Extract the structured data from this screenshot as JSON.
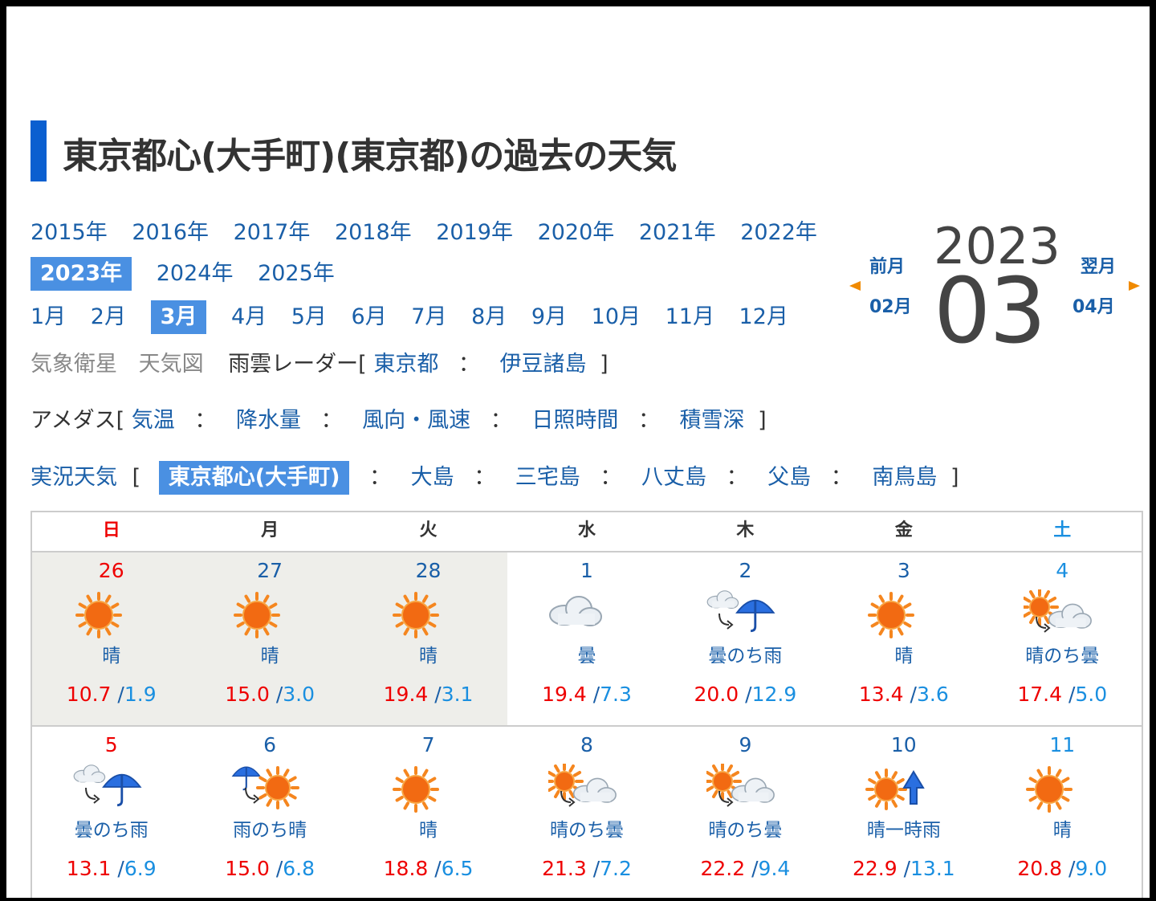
{
  "page_title": "東京都心(大手町)(東京都)の過去の天気",
  "years": [
    "2015年",
    "2016年",
    "2017年",
    "2018年",
    "2019年",
    "2020年",
    "2021年",
    "2022年",
    "2023年",
    "2024年",
    "2025年"
  ],
  "selected_year": "2023年",
  "months": [
    "1月",
    "2月",
    "3月",
    "4月",
    "5月",
    "6月",
    "7月",
    "8月",
    "9月",
    "10月",
    "11月",
    "12月"
  ],
  "selected_month": "3月",
  "links": {
    "satellite": "気象衛星",
    "weather_map": "天気図",
    "radar_label": "雨雲レーダー[",
    "radar_tokyo": "東京都",
    "radar_izu": "伊豆諸島",
    "close_bracket": "]",
    "amedas_label": "アメダス[",
    "amedas_temp": "気温",
    "amedas_rain": "降水量",
    "amedas_wind": "風向・風速",
    "amedas_sun": "日照時間",
    "amedas_snow": "積雪深",
    "actual_label": "実況天気",
    "open_bracket": "[",
    "actual_selected": "東京都心(大手町)",
    "actual_oshima": "大島",
    "actual_miyake": "三宅島",
    "actual_hachijo": "八丈島",
    "actual_chichi": "父島",
    "actual_minami": "南鳥島",
    "sep": "："
  },
  "month_nav": {
    "prev_label": "前月",
    "prev_month": "02月",
    "next_label": "翌月",
    "next_month": "04月",
    "year": "2023",
    "month": "03",
    "arrow_color": "#f08a00"
  },
  "weekdays": [
    "日",
    "月",
    "火",
    "水",
    "木",
    "金",
    "土"
  ],
  "weeks": [
    [
      {
        "day": "26",
        "icon": "sun-icon",
        "desc": "晴",
        "hi": "10.7",
        "lo": "1.9",
        "prev": true
      },
      {
        "day": "27",
        "icon": "sun-icon",
        "desc": "晴",
        "hi": "15.0",
        "lo": "3.0",
        "prev": true
      },
      {
        "day": "28",
        "icon": "sun-icon",
        "desc": "晴",
        "hi": "19.4",
        "lo": "3.1",
        "prev": true
      },
      {
        "day": "1",
        "icon": "cloud-icon",
        "desc": "曇",
        "hi": "19.4",
        "lo": "7.3",
        "prev": false
      },
      {
        "day": "2",
        "icon": "cloud-then-rain-icon",
        "desc": "曇のち雨",
        "hi": "20.0",
        "lo": "12.9",
        "prev": false
      },
      {
        "day": "3",
        "icon": "sun-icon",
        "desc": "晴",
        "hi": "13.4",
        "lo": "3.6",
        "prev": false
      },
      {
        "day": "4",
        "icon": "sun-then-cloud-icon",
        "desc": "晴のち曇",
        "hi": "17.4",
        "lo": "5.0",
        "prev": false
      }
    ],
    [
      {
        "day": "5",
        "icon": "cloud-then-rain-icon",
        "desc": "曇のち雨",
        "hi": "13.1",
        "lo": "6.9",
        "prev": false
      },
      {
        "day": "6",
        "icon": "rain-then-sun-icon",
        "desc": "雨のち晴",
        "hi": "15.0",
        "lo": "6.8",
        "prev": false
      },
      {
        "day": "7",
        "icon": "sun-icon",
        "desc": "晴",
        "hi": "18.8",
        "lo": "6.5",
        "prev": false
      },
      {
        "day": "8",
        "icon": "sun-then-cloud-icon",
        "desc": "晴のち曇",
        "hi": "21.3",
        "lo": "7.2",
        "prev": false
      },
      {
        "day": "9",
        "icon": "sun-then-cloud-icon",
        "desc": "晴のち曇",
        "hi": "22.2",
        "lo": "9.4",
        "prev": false
      },
      {
        "day": "10",
        "icon": "sun-occasional-rain-icon",
        "desc": "晴一時雨",
        "hi": "22.9",
        "lo": "13.1",
        "prev": false
      },
      {
        "day": "11",
        "icon": "sun-icon",
        "desc": "晴",
        "hi": "20.8",
        "lo": "9.0",
        "prev": false
      }
    ]
  ]
}
